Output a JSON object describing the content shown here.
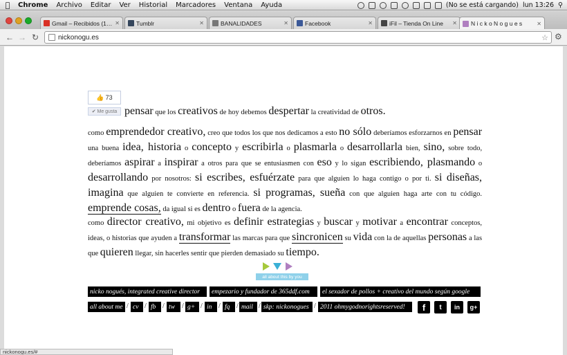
{
  "menubar": {
    "app_name": "Chrome",
    "items": [
      "Archivo",
      "Editar",
      "Ver",
      "Historial",
      "Marcadores",
      "Ventana",
      "Ayuda"
    ],
    "status_text": "(No se está cargando)",
    "clock": "lun 13:26"
  },
  "tabs": [
    {
      "label": "Gmail – Recibidos (168) –",
      "icon": "gmail-icon",
      "color": "#d93025"
    },
    {
      "label": "Tumblr",
      "icon": "tumblr-icon",
      "color": "#35465c"
    },
    {
      "label": "BANALIDADES",
      "icon": "page-icon",
      "color": "#777777"
    },
    {
      "label": "Facebook",
      "icon": "facebook-icon",
      "color": "#3b5998"
    },
    {
      "label": "iFil – Tienda On Line",
      "icon": "ifil-icon",
      "color": "#444444"
    },
    {
      "label": "N i c k o N o g u e s",
      "icon": "nicko-icon",
      "color": "#b07fc0"
    }
  ],
  "toolbar": {
    "url": "nickonogu.es"
  },
  "like": {
    "count": "73",
    "button_label": "Me gusta"
  },
  "intro": {
    "w1": "pensar",
    "w2": "que los",
    "w3": "creativos",
    "w4": "de hoy debemos",
    "w5": "despertar",
    "w6": "la creatividad de",
    "w7": "otros."
  },
  "p1": {
    "s1": "como",
    "s2": "emprendedor creativo,",
    "s3": "creo que todos los que nos dedicamos a esto",
    "s4": "no sólo",
    "s5": "deberíamos esforzarnos en",
    "s6": "pensar",
    "s7": "una buena",
    "s8": "idea, historia",
    "s9": "o",
    "s10": "concepto",
    "s11": "y",
    "s12": "escribirla",
    "s13": "o",
    "s14": "plasmarla",
    "s15": "o",
    "s16": "desarrollarla",
    "s17": "bien,",
    "s18": "sino,",
    "s19": "sobre todo, deberíamos",
    "s20": "aspirar",
    "s21": "a",
    "s22": "inspirar",
    "s23": "a otros para que se entusiasmen con",
    "s24": "eso",
    "s25": "y lo sigan",
    "s26": "escribiendo, plasmando",
    "s27": "o",
    "s28": "desarrollando",
    "s29": "por nosotros:",
    "s30": "si escribes, esfuérzate",
    "s31": "para que alguien lo haga contigo o por ti.",
    "s32": "si diseñas, imagina",
    "s33": "que alguien te convierte en referencia.",
    "s34": "si programas, sueña",
    "s35": "con que alguien haga arte con tu código.",
    "s36": "emprende cosas,",
    "s37": "da igual si es",
    "s38": "dentro",
    "s39": "o",
    "s40": "fuera",
    "s41": "de la agencia."
  },
  "p2": {
    "s1": "como",
    "s2": "director creativo,",
    "s3": "mi objetivo es",
    "s4": "definir estrategias",
    "s5": "y",
    "s6": "buscar",
    "s7": "y",
    "s8": "motivar",
    "s9": "a",
    "s10": "encontrar",
    "s11": "conceptos, ideas, o historias que ayuden a",
    "s12": "transformar",
    "s13": "las marcas para que",
    "s14": "sincronicen",
    "s15": "su",
    "s16": "vida",
    "s17": "con la de aquellas",
    "s18": "personas",
    "s19": "a las que",
    "s20": "quieren",
    "s21": "llegar, sin hacerles sentir que pierden demasiado su",
    "s22": "tiempo."
  },
  "about_button": "all about this by you",
  "footer": {
    "row1": [
      "nicko nogués, integrated creative director",
      "empezario y fundador de 365ddf.com",
      "el sexador de pollos + creativo del mundo según google"
    ],
    "row2": [
      "all about me",
      "cv",
      "fb",
      "tw",
      "g+",
      "in",
      "fq",
      "mail",
      "skp: nickonogues",
      "2011 ohmygodnorightsreserved!"
    ],
    "separator": "/",
    "social": [
      "f",
      "t",
      "in",
      "g+"
    ]
  },
  "statusbar": "nickonogu.es/#"
}
